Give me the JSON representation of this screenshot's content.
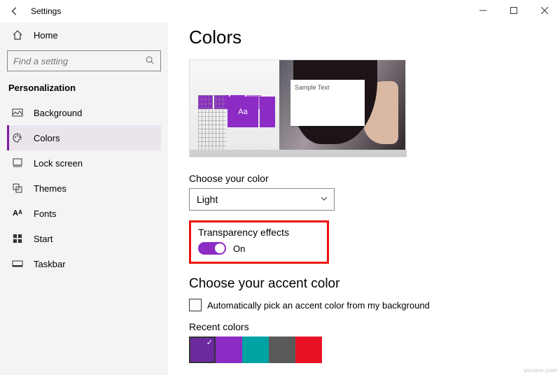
{
  "window": {
    "title": "Settings"
  },
  "sidebar": {
    "home": "Home",
    "search_placeholder": "Find a setting",
    "category": "Personalization",
    "items": [
      {
        "label": "Background"
      },
      {
        "label": "Colors"
      },
      {
        "label": "Lock screen"
      },
      {
        "label": "Themes"
      },
      {
        "label": "Fonts"
      },
      {
        "label": "Start"
      },
      {
        "label": "Taskbar"
      }
    ]
  },
  "main": {
    "page_title": "Colors",
    "preview": {
      "tile_text": "Aa",
      "sample_text": "Sample Text"
    },
    "choose_color_label": "Choose your color",
    "choose_color_value": "Light",
    "transparency_label": "Transparency effects",
    "transparency_state": "On",
    "accent_heading": "Choose your accent color",
    "auto_accent_label": "Automatically pick an accent color from my background",
    "recent_colors_label": "Recent colors",
    "recent_colors": [
      "#6b2aa0",
      "#8c2cc4",
      "#00a3a3",
      "#5a5a5a",
      "#e81123"
    ]
  },
  "watermark": "wsxwm.com"
}
